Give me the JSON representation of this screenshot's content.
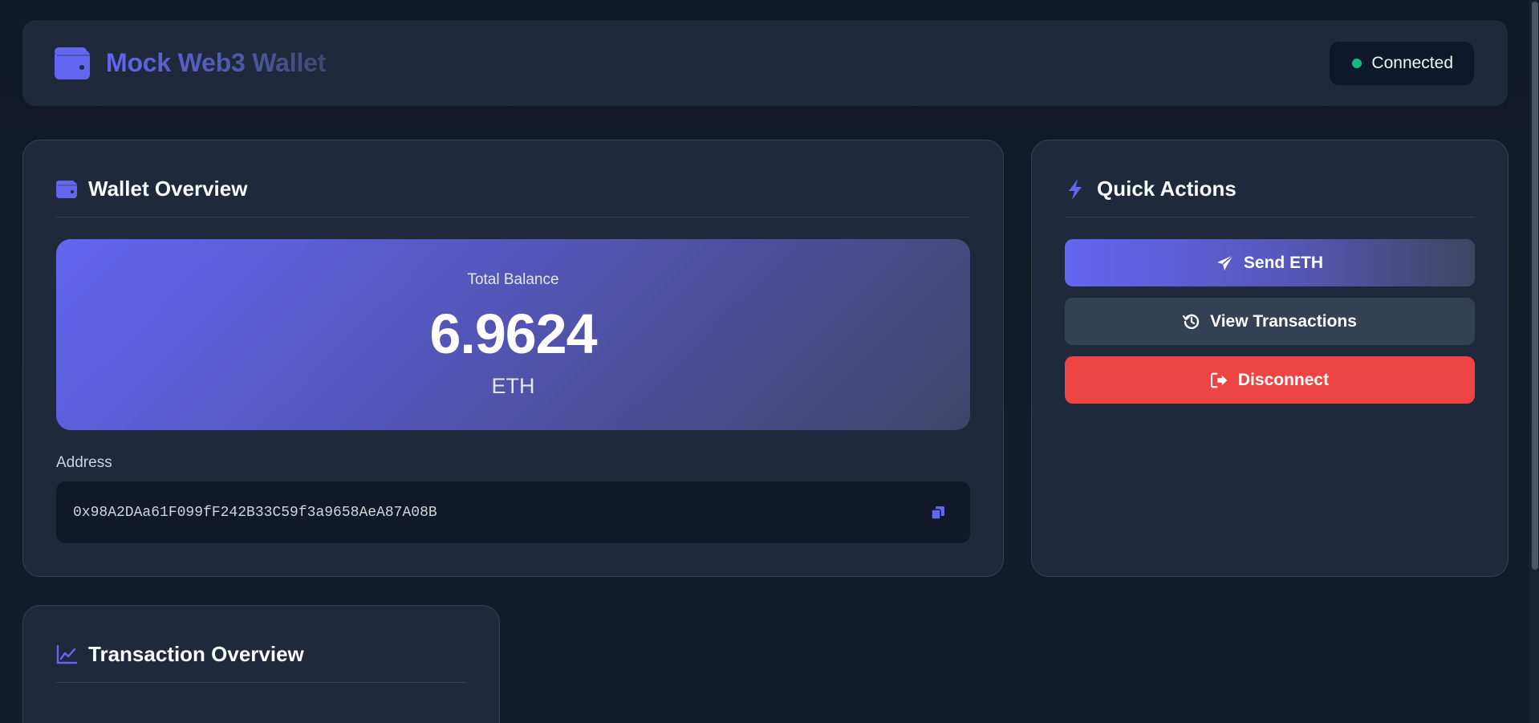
{
  "header": {
    "app_title": "Mock Web3 Wallet",
    "status_label": "Connected"
  },
  "wallet_overview": {
    "title": "Wallet Overview",
    "balance_label": "Total Balance",
    "balance_value": "6.9624",
    "balance_unit": "ETH",
    "address_label": "Address",
    "address": "0x98A2DAa61F099fF242B33C59f3a9658AeA87A08B"
  },
  "quick_actions": {
    "title": "Quick Actions",
    "send_label": "Send ETH",
    "view_label": "View Transactions",
    "disconnect_label": "Disconnect"
  },
  "transaction_overview": {
    "title": "Transaction Overview"
  },
  "colors": {
    "accent": "#6366f1",
    "status_ok": "#10b981",
    "danger": "#ef4444",
    "card_bg": "#1e293b",
    "page_bg": "#111827"
  },
  "icons": {
    "brand": "wallet-icon",
    "status": "status-dot",
    "overview": "wallet-icon",
    "quick_actions": "bolt-icon",
    "copy": "copy-icon",
    "send": "paper-plane-icon",
    "view": "history-icon",
    "disconnect": "sign-out-icon",
    "transactions": "chart-line-icon"
  }
}
